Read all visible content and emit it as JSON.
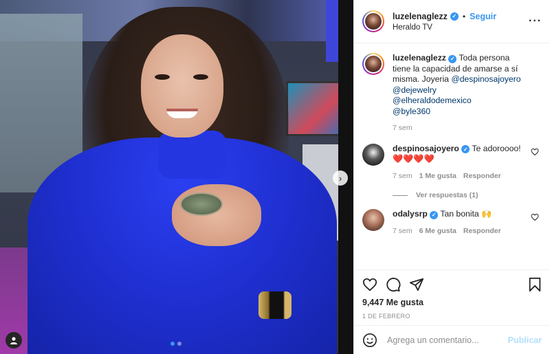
{
  "post": {
    "username": "luzelenaglezz",
    "follow_label": "Seguir",
    "separator": "•",
    "location": "Heraldo TV",
    "more_label": "···"
  },
  "caption": {
    "username": "luzelenaglezz",
    "text": "Toda persona tiene la capacidad de amarse a sí misma. Joyeria",
    "mentions": [
      "@despinosajoyero",
      "@dejewelry",
      "@elheraldodemexico",
      "@byle360"
    ],
    "time": "7 sem"
  },
  "comments": [
    {
      "username": "despinosajoyero",
      "text": "Te adoroooo! ❤️❤️❤️❤️",
      "time": "7 sem",
      "likes": "1 Me gusta",
      "reply_label": "Responder",
      "view_replies": "Ver respuestas (1)"
    },
    {
      "username": "odalysrp",
      "text": "Tan bonita 🙌",
      "time": "7 sem",
      "likes": "6 Me gusta",
      "reply_label": "Responder"
    }
  ],
  "footer": {
    "likes": "9,447 Me gusta",
    "date": "1 DE FEBRERO",
    "comment_placeholder": "Agrega un comentario...",
    "publish_label": "Publicar"
  },
  "carousel": {
    "current": 1,
    "total": 2
  },
  "colors": {
    "accent": "#3897f0",
    "publish_disabled": "#b2dffc",
    "sweater": "#1f2fd0"
  }
}
